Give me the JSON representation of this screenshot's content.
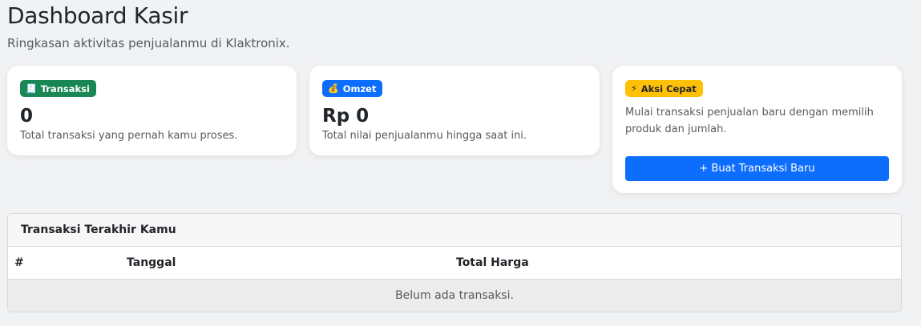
{
  "header": {
    "title": "Dashboard Kasir",
    "subtitle": "Ringkasan aktivitas penjualanmu di Klaktronix."
  },
  "cards": {
    "transaksi": {
      "badge_icon": "receipt-icon",
      "badge_glyph": "🧾",
      "badge_label": "Transaksi",
      "value": "0",
      "description": "Total transaksi yang pernah kamu proses."
    },
    "omzet": {
      "badge_icon": "money-bag-icon",
      "badge_glyph": "💰",
      "badge_label": "Omzet",
      "value": "Rp 0",
      "description": "Total nilai penjualanmu hingga saat ini."
    },
    "aksi": {
      "badge_icon": "lightning-icon",
      "badge_glyph": "⚡",
      "badge_label": "Aksi Cepat",
      "description": "Mulai transaksi penjualan baru dengan memilih produk dan jumlah.",
      "button_label": "+ Buat Transaksi Baru"
    }
  },
  "recent_table": {
    "title": "Transaksi Terakhir Kamu",
    "columns": [
      "#",
      "Tanggal",
      "Total Harga"
    ],
    "empty_message": "Belum ada transaksi."
  },
  "colors": {
    "success": "#198754",
    "primary": "#0d6efd",
    "warning": "#ffc107",
    "background": "#f1f2f4"
  }
}
